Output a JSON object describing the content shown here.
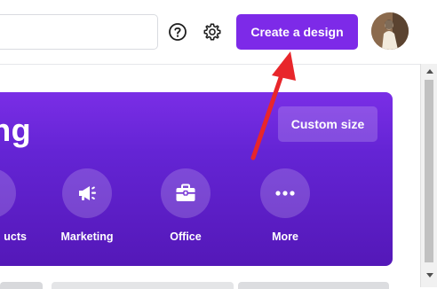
{
  "topbar": {
    "search_value": "",
    "help_icon": "question-circle-icon",
    "settings_icon": "gear-icon",
    "create_button_label": "Create a design"
  },
  "banner": {
    "title_fragment": "ing",
    "custom_size_label": "Custom size",
    "categories": [
      {
        "label": "ucts",
        "icon": "products-icon"
      },
      {
        "label": "Marketing",
        "icon": "megaphone-icon"
      },
      {
        "label": "Office",
        "icon": "briefcase-icon"
      },
      {
        "label": "More",
        "icon": "more-dots-icon"
      }
    ]
  },
  "colors": {
    "brand_purple": "#7d2ae8",
    "annotation_arrow": "#e8262b"
  }
}
